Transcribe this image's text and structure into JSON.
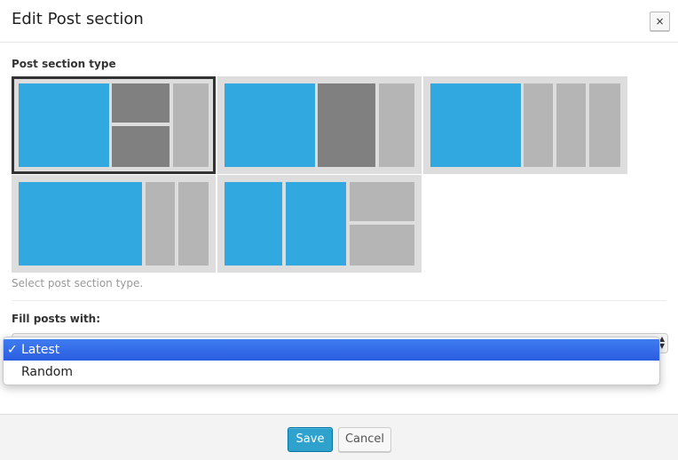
{
  "dialog": {
    "title": "Edit Post section",
    "close_label": "×"
  },
  "post_section_type": {
    "label": "Post section type",
    "help": "Select post section type.",
    "options": [
      {
        "name": "layout-1-big-2stack-1tall",
        "selected": true
      },
      {
        "name": "layout-1-big-1dark-1tall",
        "selected": false
      },
      {
        "name": "layout-1-big-3tall",
        "selected": false
      },
      {
        "name": "layout-1-wide-2tall",
        "selected": false
      },
      {
        "name": "layout-2-blue-2stack",
        "selected": false
      }
    ],
    "colors": {
      "primary": "#32a8e0",
      "dark": "#808080",
      "light": "#b5b5b5",
      "selected_border": "#333333"
    }
  },
  "fill_posts": {
    "label": "Fill posts with:",
    "selected": "Latest",
    "options": [
      {
        "label": "Latest",
        "check": "✓"
      },
      {
        "label": "Random"
      }
    ]
  },
  "footer": {
    "save_label": "Save",
    "cancel_label": "Cancel"
  }
}
